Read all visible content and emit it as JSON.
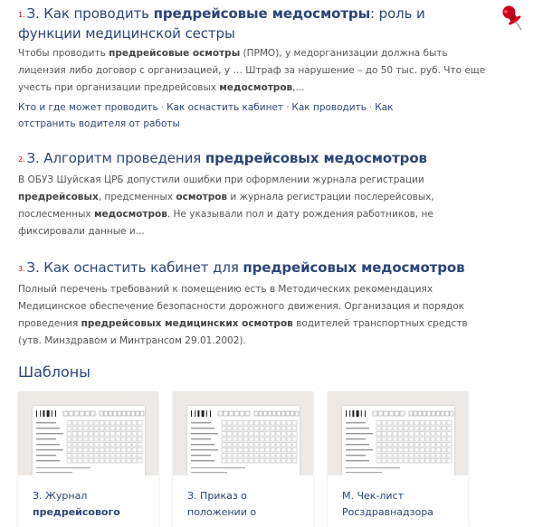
{
  "results": [
    {
      "num": "1.",
      "title_prefix": "З. Как проводить ",
      "title_bold": "предрейсовые медосмотры",
      "title_suffix": ": роль и функции медицинской сестры",
      "snippet": [
        {
          "t": "Чтобы проводить ",
          "b": false
        },
        {
          "t": "предрейсовые осмотры",
          "b": true
        },
        {
          "t": " (ПРМО), у медорганизации должна быть лицензия либо договор с организацией, у … Штраф за нарушение – до 50 тыс. руб. Что еще учесть при организации предрейсовых ",
          "b": false
        },
        {
          "t": "медосмотров",
          "b": true
        },
        {
          "t": ",...",
          "b": false
        }
      ],
      "links": [
        "Кто и где может проводить",
        "Как оснастить кабинет",
        "Как проводить",
        "Как отстранить водителя от работы"
      ],
      "link_separator": "·"
    },
    {
      "num": "2.",
      "title_prefix": "З. Алгоритм проведения ",
      "title_bold": "предрейсовых медосмотров",
      "title_suffix": "",
      "snippet": [
        {
          "t": "В ОБУЗ Шуйская ЦРБ допустили ошибки при оформлении журнала регистрации ",
          "b": false
        },
        {
          "t": "предрейсовых",
          "b": true
        },
        {
          "t": ", предсменных ",
          "b": false
        },
        {
          "t": "осмотров",
          "b": true
        },
        {
          "t": " и журнала регистрации послерейсовых, послесменных ",
          "b": false
        },
        {
          "t": "медосмотров",
          "b": true
        },
        {
          "t": ". Не указывали пол и дату рождения работников, не фиксировали данные и...",
          "b": false
        }
      ],
      "links": []
    },
    {
      "num": "3.",
      "title_prefix": "З. Как оснастить кабинет для ",
      "title_bold": "предрейсовых медосмотров",
      "title_suffix": "",
      "snippet": [
        {
          "t": "Полный перечень требований к помещению есть в Методических рекомендациях Медицинское обеспечение безопасности дорожного движения. Организация и порядок проведения ",
          "b": false
        },
        {
          "t": "предрейсовых медицинских осмотров",
          "b": true
        },
        {
          "t": " водителей транспортных средств (утв. Минздравом и Минтрансом 29.01.2002).",
          "b": false
        }
      ],
      "links": []
    }
  ],
  "templates": {
    "heading": "Шаблоны",
    "cards": [
      {
        "line1": "З. Журнал",
        "line2": "предрейсового",
        "line2_bold": true
      },
      {
        "line1": "З. Приказ о",
        "line2": "положении о",
        "line2_bold": false
      },
      {
        "line1": "М. Чек-лист",
        "line2": "Росздравнадзора",
        "line2_bold": false
      }
    ]
  },
  "colors": {
    "link": "#2a4579",
    "number": "#d0021b",
    "pin": "#d0021b",
    "thumb_bg": "#ece9e6"
  },
  "icons": {
    "pin": "pushpin-icon"
  }
}
